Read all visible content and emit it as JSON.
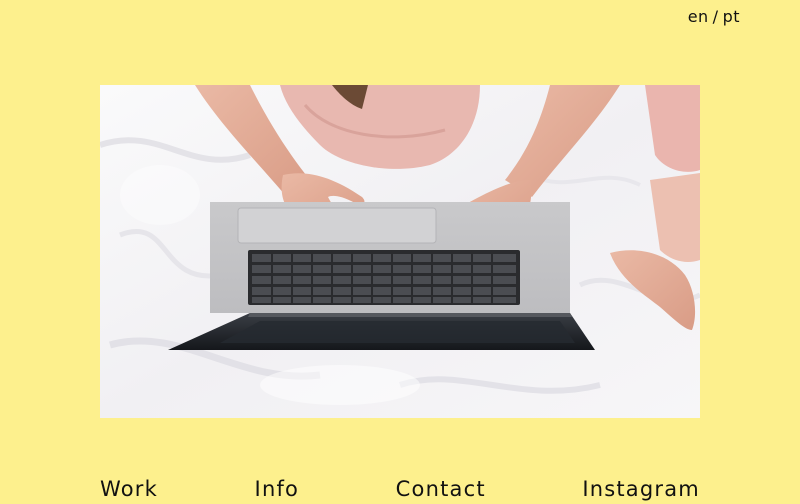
{
  "language_switch": {
    "en": "en",
    "separator": "/",
    "pt": "pt"
  },
  "hero_image": {
    "alt": "Person on a bed typing on a laptop"
  },
  "nav": {
    "work": "Work",
    "info": "Info",
    "contact": "Contact",
    "instagram": "Instagram"
  },
  "colors": {
    "background": "#fdf08d",
    "text": "#111111"
  }
}
